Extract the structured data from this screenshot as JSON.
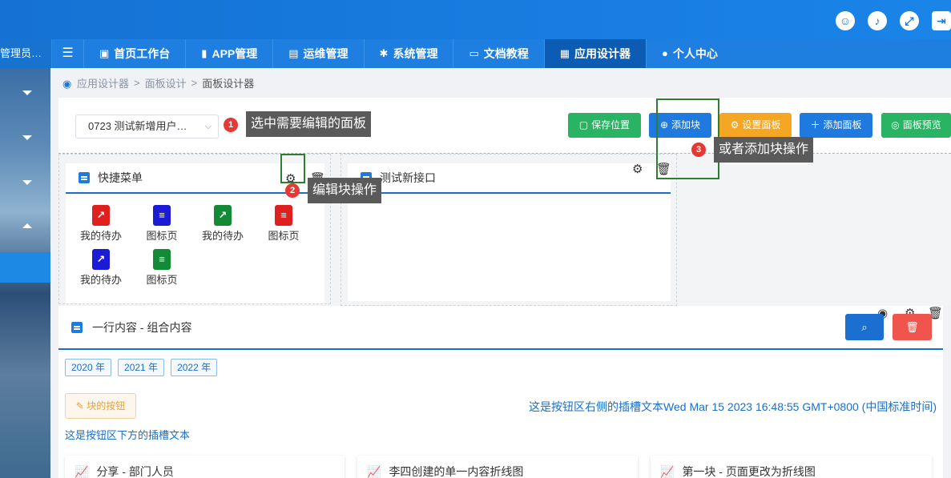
{
  "topbar": {
    "icons": [
      "footprint-icon",
      "bell-icon",
      "fullscreen-icon",
      "exit-icon"
    ]
  },
  "nav": {
    "user": "管理员…",
    "items": [
      {
        "label": "首页工作台",
        "icon": "monitor-icon"
      },
      {
        "label": "APP管理",
        "icon": "phone-icon"
      },
      {
        "label": "运维管理",
        "icon": "clipboard-icon"
      },
      {
        "label": "系统管理",
        "icon": "gear-icon"
      },
      {
        "label": "文档教程",
        "icon": "folder-icon"
      },
      {
        "label": "应用设计器",
        "icon": "design-icon",
        "active": true
      },
      {
        "label": "个人中心",
        "icon": "user-icon"
      }
    ]
  },
  "breadcrumb": {
    "a": "应用设计器",
    "b": "面板设计",
    "c": "面板设计器",
    "sep": ">"
  },
  "toolbar": {
    "select_value": "0723 测试新增用户…",
    "save": "保存位置",
    "add_block": "添加块",
    "set_panel": "设置面板",
    "add_panel": "添加面板",
    "preview": "面板预览"
  },
  "annotations": {
    "n1": "1",
    "t1": "选中需要编辑的面板",
    "n2": "2",
    "t2": "编辑块操作",
    "n3": "3",
    "t3": "或者添加块操作"
  },
  "block1": {
    "title": "快捷菜单",
    "items": [
      {
        "label": "我的待办",
        "color": "red",
        "icon": "arrow-out-icon"
      },
      {
        "label": "图标页",
        "color": "blue",
        "icon": "notebook-icon"
      },
      {
        "label": "我的待办",
        "color": "green",
        "icon": "arrow-out-icon"
      },
      {
        "label": "图标页",
        "color": "red",
        "icon": "notebook-icon"
      },
      {
        "label": "我的待办",
        "color": "blue",
        "icon": "arrow-out-icon"
      },
      {
        "label": "图标页",
        "color": "green",
        "icon": "notebook-icon"
      }
    ]
  },
  "block2": {
    "title": "测试新接口"
  },
  "card2": {
    "title": "一行内容 - 组合内容",
    "years": [
      "2020 年",
      "2021 年",
      "2022 年"
    ],
    "block_button": "块的按钮",
    "slot_right": "这是按钮区右侧的插槽文本Wed Mar 15 2023 16:48:55 GMT+0800 (中国标准时间)",
    "slot_below": "这是按钮区下方的插槽文本",
    "subcards": [
      "分享 - 部门人员",
      "李四创建的单一内容折线图",
      "第一块 - 页面更改为折线图"
    ]
  },
  "colors": {
    "primary": "#1f7ae0",
    "success": "#28b463",
    "warning": "#f5a623",
    "danger": "#f0554d"
  }
}
